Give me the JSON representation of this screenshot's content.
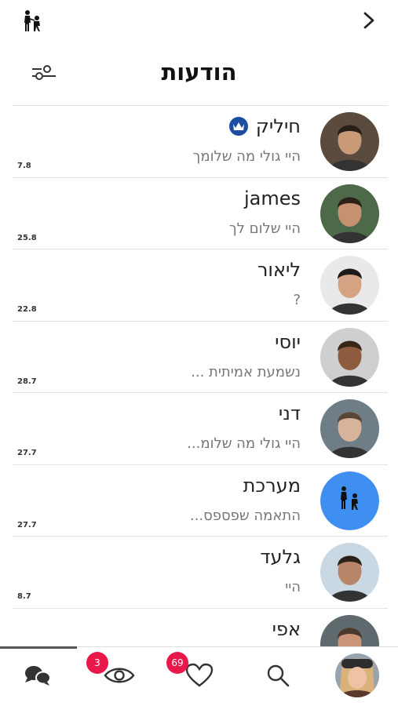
{
  "header": {
    "title": "הודעות",
    "logo_icon": "couple-proposal-logo",
    "back_icon": "chevron-right-icon",
    "filter_icon": "filter-sliders-icon"
  },
  "conversations": [
    {
      "name": "חיליק",
      "premium": true,
      "preview": "היי גולי מה שלומך",
      "distance": "7.8",
      "avatar_bg": "#5b4a3e",
      "avatar_skin": "#c89a78",
      "avatar_hair": "#2a1f17"
    },
    {
      "name": "james",
      "premium": false,
      "preview": "היי שלום לך",
      "distance": "25.8",
      "avatar_bg": "#4d6a48",
      "avatar_skin": "#c69170",
      "avatar_hair": "#2b2118"
    },
    {
      "name": "ליאור",
      "premium": false,
      "preview": "?",
      "distance": "22.8",
      "avatar_bg": "#e9e9e9",
      "avatar_skin": "#d4a383",
      "avatar_hair": "#1e1a17"
    },
    {
      "name": "יוסי",
      "premium": false,
      "preview": "נשמעת אמיתית ...",
      "distance": "28.7",
      "avatar_bg": "#cfcfcf",
      "avatar_skin": "#8d5c3e",
      "avatar_hair": "#3a2617"
    },
    {
      "name": "דני",
      "premium": false,
      "preview": "היי גולי מה שלומ...",
      "distance": "27.7",
      "avatar_bg": "#6f7d86",
      "avatar_skin": "#d6b39a",
      "avatar_hair": "#5a4636"
    },
    {
      "name": "מערכת",
      "premium": false,
      "preview": "התאמה שפספס...",
      "distance": "27.7",
      "avatar_bg": "#3f8ff0",
      "system": true
    },
    {
      "name": "גלעד",
      "premium": false,
      "preview": "היי",
      "distance": "8.7",
      "avatar_bg": "#c9d8e3",
      "avatar_skin": "#b98568",
      "avatar_hair": "#2a211a"
    },
    {
      "name": "אפי",
      "premium": false,
      "preview": "",
      "distance": "",
      "avatar_bg": "#5f6a6e",
      "avatar_skin": "#c99477",
      "avatar_hair": "#4a382b"
    }
  ],
  "nav": {
    "chat_icon": "chat-bubbles-icon",
    "views_icon": "eye-icon",
    "views_badge": "3",
    "likes_icon": "heart-icon",
    "likes_badge": "69",
    "search_icon": "search-icon",
    "profile_icon": "profile-avatar",
    "badge_color": "#e8184a"
  }
}
